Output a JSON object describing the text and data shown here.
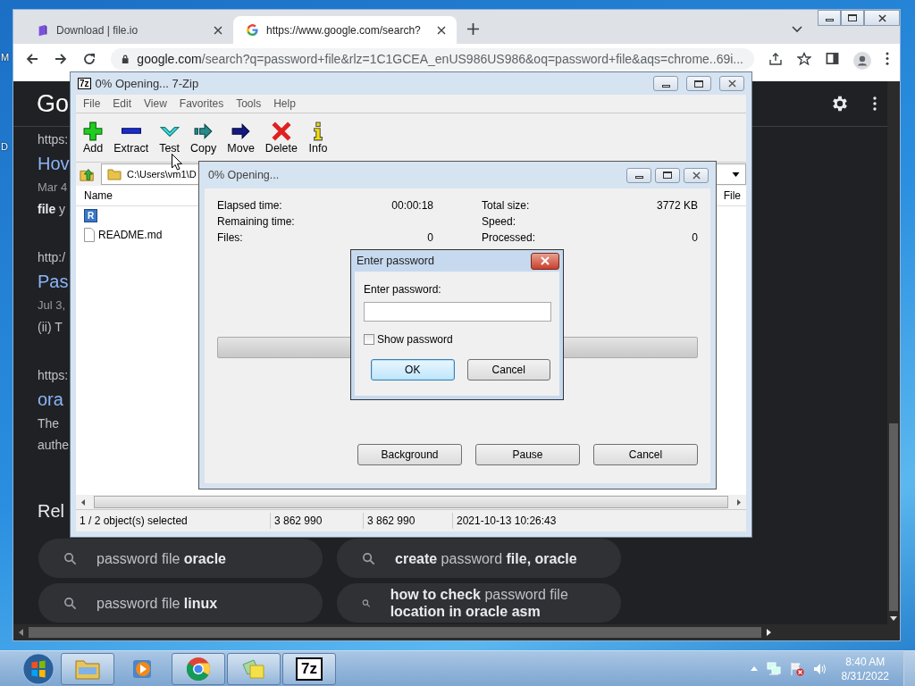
{
  "desktop": {
    "icon_labels": [
      "M",
      "D"
    ]
  },
  "browser": {
    "tabs": [
      {
        "title": "Download | file.io",
        "kind": "fileio",
        "selected": false
      },
      {
        "title": "https://www.google.com/search?",
        "kind": "google",
        "selected": true
      }
    ],
    "address": {
      "host": "google.com",
      "path": "/search?q=password+file&rlz=1C1GCEA_enUS986US986&oq=password+file&aqs=chrome..69i..."
    },
    "page": {
      "logo": "Go",
      "results": [
        {
          "kind": "url",
          "text": "https:"
        },
        {
          "kind": "title",
          "text": "Hov"
        },
        {
          "kind": "date",
          "text": "Mar 4"
        },
        {
          "kind": "snippet",
          "text": "**file** y"
        },
        {
          "kind": "url",
          "text": "http:/"
        },
        {
          "kind": "title",
          "text": "Pas"
        },
        {
          "kind": "date",
          "text": "Jul 3,"
        },
        {
          "kind": "snippet",
          "text": "(ii) T"
        },
        {
          "kind": "url",
          "text": "https:"
        },
        {
          "kind": "title",
          "text": "ora"
        },
        {
          "kind": "snippet",
          "text": "The"
        },
        {
          "kind": "snippet",
          "text": "authe"
        }
      ],
      "related_heading": "Rel",
      "related": [
        "password file **oracle**",
        "password file **linux**",
        "**create** password **file, oracle**",
        "**how to check** password file **location in oracle asm**"
      ]
    }
  },
  "archive_window": {
    "title": "0% Opening... 7-Zip",
    "icon_text": "7z",
    "menu": [
      "File",
      "Edit",
      "View",
      "Favorites",
      "Tools",
      "Help"
    ],
    "toolbar": [
      {
        "label": "Add",
        "kind": "add"
      },
      {
        "label": "Extract",
        "kind": "extract"
      },
      {
        "label": "Test",
        "kind": "test"
      },
      {
        "label": "Copy",
        "kind": "copy"
      },
      {
        "label": "Move",
        "kind": "move"
      },
      {
        "label": "Delete",
        "kind": "delete"
      },
      {
        "label": "Info",
        "kind": "info"
      }
    ],
    "path": "C:\\Users\\vm1\\D",
    "columns": [
      "Name",
      "File"
    ],
    "files": [
      {
        "kind": "archive",
        "icon_text": "R",
        "selected": false
      },
      {
        "kind": "document",
        "name": "README.md",
        "selected": false
      }
    ],
    "status": [
      "1 / 2 object(s) selected",
      "3 862 990",
      "3 862 990",
      "2021-10-13 10:26:43"
    ]
  },
  "progress_dialog": {
    "title": "0% Opening...",
    "stats": [
      [
        {
          "label": "Elapsed time:",
          "value": "00:00:18"
        },
        {
          "label": "Remaining time:"
        },
        {
          "label": "Files:",
          "value": "0"
        }
      ],
      [
        {
          "label": "Total size:",
          "value": "3772 KB"
        },
        {
          "label": "Speed:"
        },
        {
          "label": "Processed:",
          "value": "0"
        }
      ]
    ],
    "progress": {
      "level": 0
    },
    "buttons": [
      "Background",
      "Pause",
      "Cancel"
    ]
  },
  "password_dialog": {
    "title": "Enter password",
    "label": "Enter password:",
    "show_password": {
      "label": "Show password",
      "checked": false
    },
    "buttons": [
      {
        "label": "OK",
        "default": true
      },
      {
        "label": "Cancel",
        "default": false
      }
    ]
  },
  "taskbar": {
    "apps": [
      {
        "kind": "explorer",
        "open": true
      },
      {
        "kind": "media",
        "open": false
      },
      {
        "kind": "chrome",
        "open": true
      },
      {
        "kind": "notes",
        "open": true
      },
      {
        "kind": "sevenzip",
        "open": true,
        "icon_text": "7z"
      }
    ],
    "time": "8:40 AM",
    "date": "8/31/2022"
  }
}
